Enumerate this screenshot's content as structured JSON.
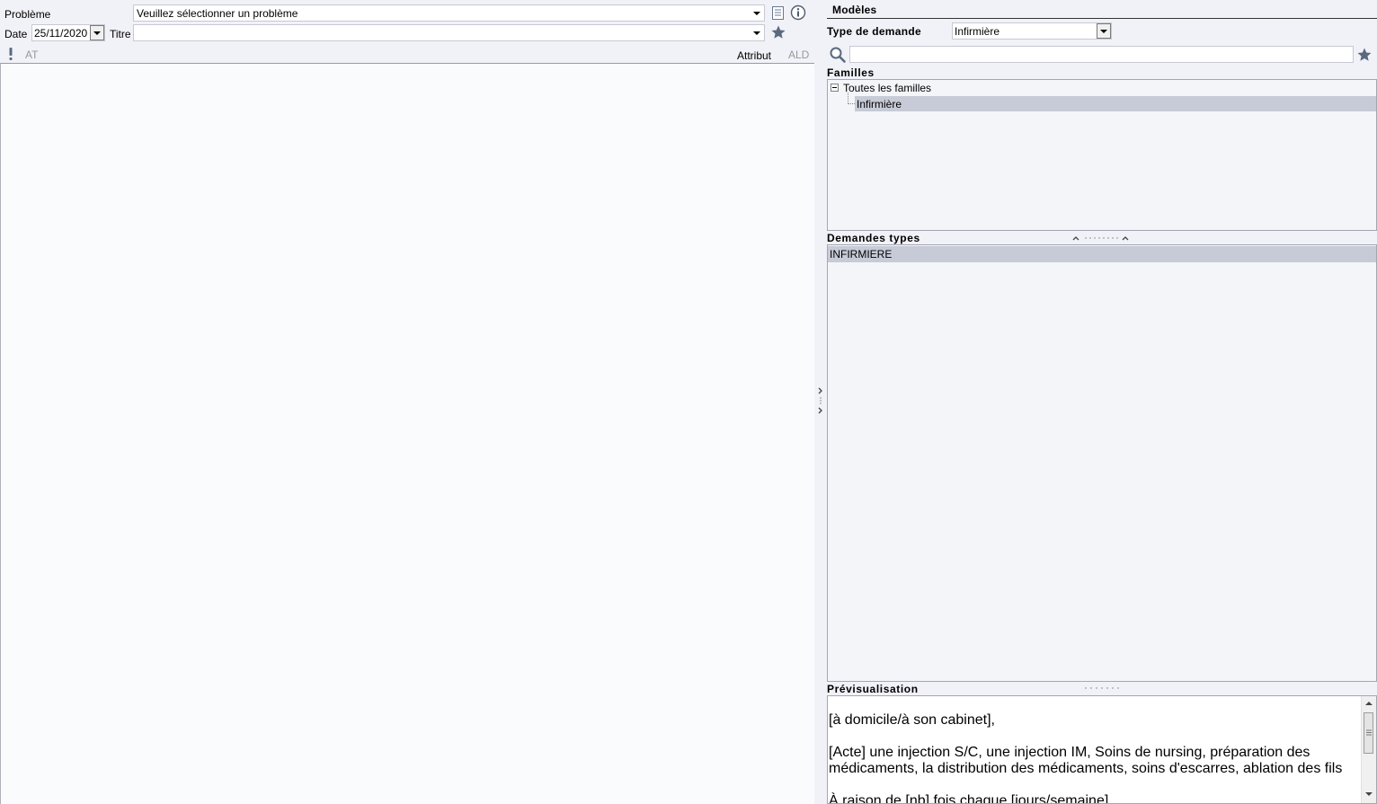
{
  "left": {
    "probleme_label": "Problème",
    "probleme_value": "Veuillez sélectionner un problème",
    "date_label": "Date",
    "date_value": "25/11/2020",
    "titre_label": "Titre",
    "titre_value": "",
    "flag_at": "AT",
    "flag_attribut": "Attribut",
    "flag_ald": "ALD"
  },
  "right": {
    "modeles_title": "Modèles",
    "type_demande_label": "Type de demande",
    "type_demande_value": "Infirmière",
    "search_value": "",
    "familles_title": "Familles",
    "tree": {
      "root": "Toutes les familles",
      "child": "Infirmière"
    },
    "demandes_title": "Demandes types",
    "demandes_items": [
      "INFIRMIERE"
    ],
    "preview_title": "Prévisualisation",
    "preview_lines": [
      "[à domicile/à son cabinet],",
      "[Acte] une injection S/C, une injection IM, Soins de nursing, préparation des",
      "médicaments, la distribution des médicaments, soins d'escarres, ablation des fils",
      "À raison de [nb] fois chaque [jours/semaine]"
    ]
  },
  "colors": {
    "header_bg": "#f1f1f8",
    "selection": "#c7cbd7",
    "star": "#5a6a7e"
  }
}
